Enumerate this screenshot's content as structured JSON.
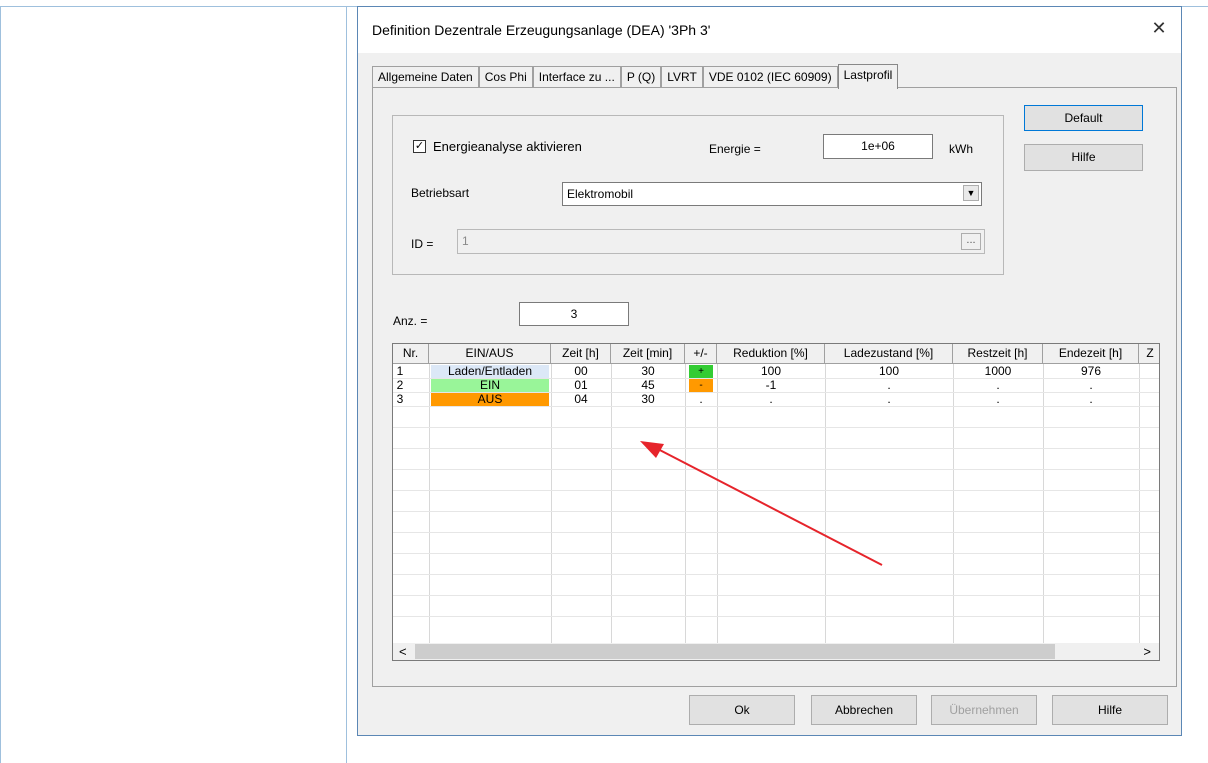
{
  "dialog": {
    "title": "Definition Dezentrale Erzeugungsanlage (DEA) '3Ph 3'",
    "close_glyph": "✕"
  },
  "tabs": [
    {
      "label": "Allgemeine Daten"
    },
    {
      "label": "Cos Phi"
    },
    {
      "label": "Interface zu ..."
    },
    {
      "label": "P (Q)"
    },
    {
      "label": "LVRT"
    },
    {
      "label": "VDE 0102 (IEC 60909)"
    },
    {
      "label": "Lastprofil"
    }
  ],
  "side_buttons": {
    "default": "Default",
    "help": "Hilfe"
  },
  "energy": {
    "checkbox_label": "Energieanalyse aktivieren",
    "checked_glyph": "✓",
    "energy_label": "Energie =",
    "energy_value": "1e+06",
    "energy_unit": "kWh",
    "mode_label": "Betriebsart",
    "mode_value": "Elektromobil",
    "id_label": "ID =",
    "id_value": "1",
    "browse_label": "..."
  },
  "count": {
    "label": "Anz. =",
    "value": "3"
  },
  "grid": {
    "headers": [
      "Nr.",
      "EIN/AUS",
      "Zeit [h]",
      "Zeit [min]",
      "+/-",
      "Reduktion [%]",
      "Ladezustand [%]",
      "Restzeit [h]",
      "Endezeit [h]",
      "Z"
    ],
    "rows": [
      [
        "1",
        "Laden/Entladen",
        "00",
        "30",
        "+",
        "100",
        "100",
        "1000",
        "976"
      ],
      [
        "2",
        "EIN",
        "01",
        "45",
        "-",
        "-1",
        ".",
        ".",
        "."
      ],
      [
        "3",
        "AUS",
        "04",
        "30",
        ".",
        ".",
        ".",
        ".",
        "."
      ]
    ],
    "scroll_left": "<",
    "scroll_right": ">"
  },
  "colors": {
    "laden": "#dce8f7",
    "ein": "#99f599",
    "aus": "#ff9900",
    "plus": "#33cc33",
    "minus": "#ff9900",
    "arrow": "#e6242b"
  },
  "footer": {
    "ok": "Ok",
    "cancel": "Abbrechen",
    "apply": "Übernehmen",
    "help": "Hilfe"
  }
}
